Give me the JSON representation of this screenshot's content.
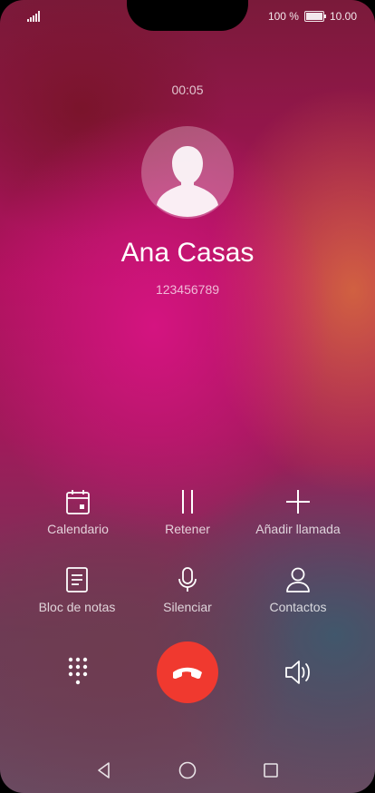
{
  "status": {
    "battery": "100 %",
    "time": "10.00"
  },
  "call": {
    "duration": "00:05",
    "name": "Ana Casas",
    "number": "123456789"
  },
  "actions": {
    "calendar": "Calendario",
    "hold": "Retener",
    "add_call": "Añadir llamada",
    "notes": "Bloc de notas",
    "mute": "Silenciar",
    "contacts": "Contactos"
  },
  "icons": {
    "signal": "signal-icon",
    "battery": "battery-icon",
    "avatar": "person-icon",
    "calendar": "calendar-icon",
    "hold": "pause-icon",
    "add_call": "plus-icon",
    "notes": "notepad-icon",
    "mute": "microphone-icon",
    "contacts": "person-outline-icon",
    "dialpad": "dialpad-icon",
    "end_call": "hang-up-icon",
    "speaker": "speaker-icon",
    "back": "back-triangle-icon",
    "home": "home-circle-icon",
    "recents": "recents-square-icon"
  },
  "colors": {
    "end_call": "#f0392f",
    "text": "#ffffff"
  }
}
